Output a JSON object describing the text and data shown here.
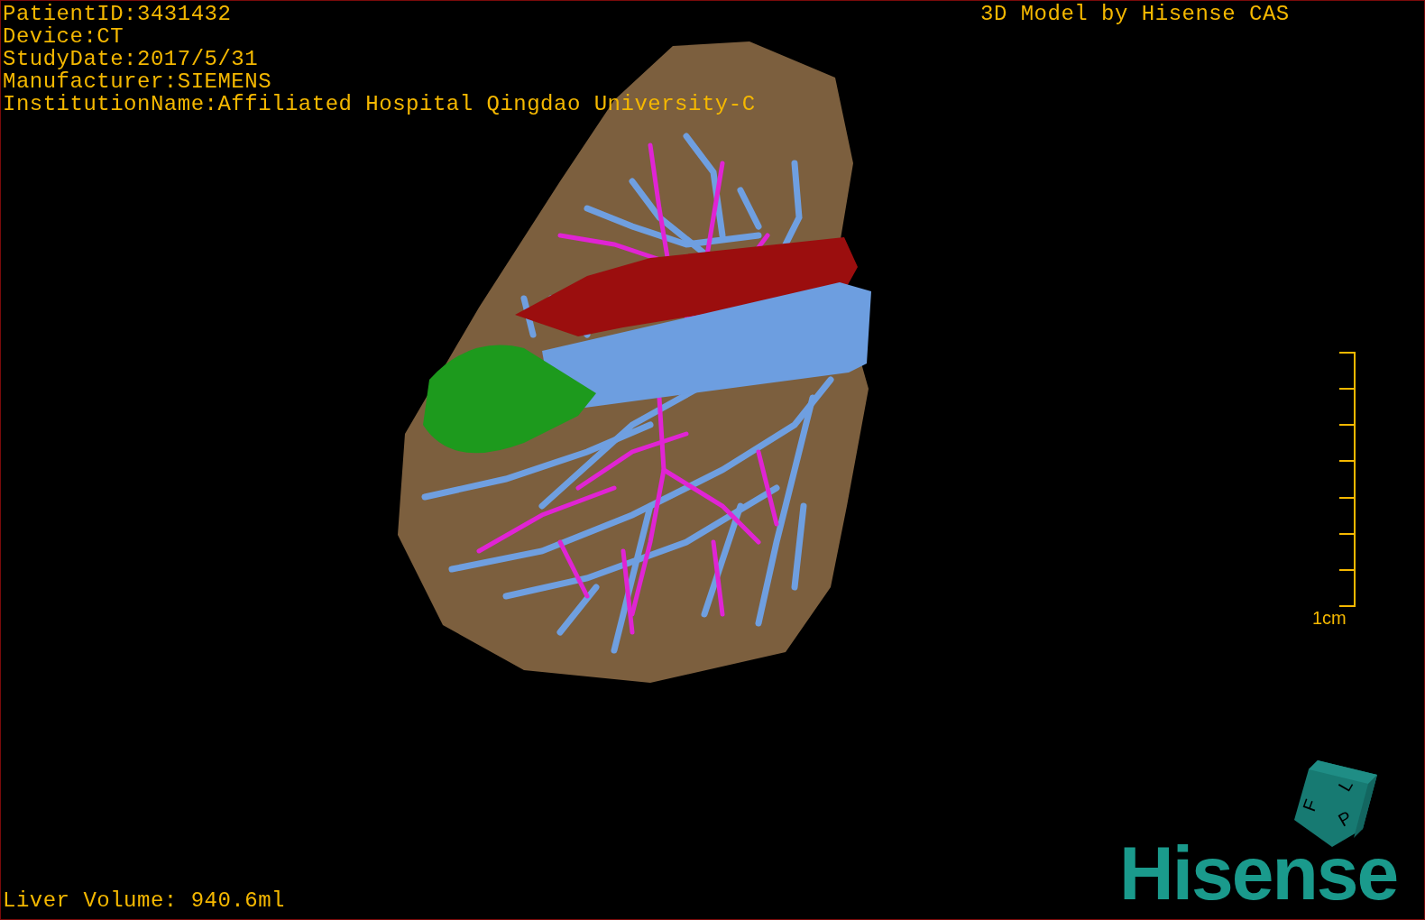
{
  "study_info": [
    "PatientID:3431432",
    "Device:CT",
    "StudyDate:2017/5/31",
    "Manufacturer:SIEMENS",
    "InstitutionName:Affiliated Hospital Qingdao University-C"
  ],
  "model_credit": "3D Model by Hisense CAS",
  "scale_bar": {
    "label": "1cm"
  },
  "liver_volume": "Liver Volume: 940.6ml",
  "orientation_cube": {
    "faces": [
      "F",
      "L",
      "P"
    ]
  },
  "logo": "Hisense"
}
